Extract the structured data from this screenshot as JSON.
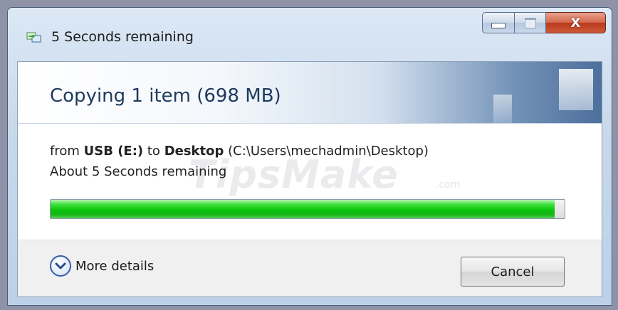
{
  "window": {
    "title": "5 Seconds remaining",
    "icon": "copy-files-icon",
    "minimize_icon": "minimize-icon",
    "maximize_icon": "maximize-icon",
    "close_icon": "close-icon",
    "close_glyph": "X"
  },
  "header": {
    "title": "Copying 1 item (698 MB)"
  },
  "transfer": {
    "from_prefix": "from",
    "source": "USB (E:)",
    "to_word": "to",
    "destination": "Desktop",
    "destination_path": "(C:\\Users\\mechadmin\\Desktop)",
    "time_remaining": "About 5 Seconds remaining",
    "progress": 0.98
  },
  "watermark": {
    "text": "TipsMake",
    "suffix": ".com"
  },
  "footer": {
    "more_details_label": "More details",
    "more_details_icon": "chevron-down-circle-icon",
    "cancel_label": "Cancel"
  },
  "colors": {
    "progress_green": "#0cc40c",
    "header_text": "#1e3a5f",
    "close_red": "#c7492b"
  }
}
